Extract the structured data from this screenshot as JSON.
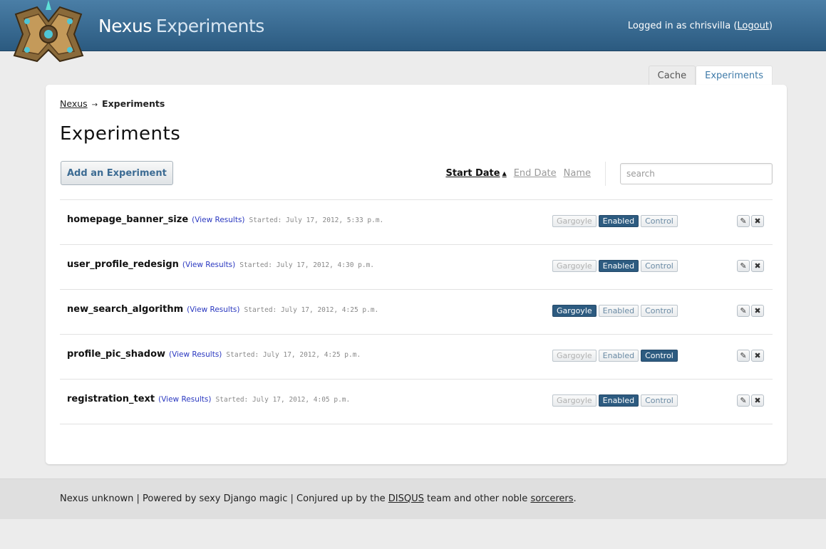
{
  "header": {
    "brand_main": "Nexus",
    "brand_sub": "Experiments",
    "logged_in_text": "Logged in as chrisvilla (",
    "logout_label": "Logout",
    "close_paren": ")"
  },
  "tabs": [
    {
      "label": "Cache",
      "active": false
    },
    {
      "label": "Experiments",
      "active": true
    }
  ],
  "breadcrumb": {
    "root": "Nexus",
    "current": "Experiments"
  },
  "page_title": "Experiments",
  "toolbar": {
    "add_label": "Add an Experiment",
    "sort": {
      "start_date": "Start Date",
      "end_date": "End Date",
      "name": "Name"
    },
    "search_placeholder": "search"
  },
  "experiments": [
    {
      "name": "homepage_banner_size",
      "results_label": "(View Results)",
      "started": "Started: July 17, 2012, 5:33 p.m.",
      "state": "Enabled"
    },
    {
      "name": "user_profile_redesign",
      "results_label": "(View Results)",
      "started": "Started: July 17, 2012, 4:30 p.m.",
      "state": "Enabled"
    },
    {
      "name": "new_search_algorithm",
      "results_label": "(View Results)",
      "started": "Started: July 17, 2012, 4:25 p.m.",
      "state": "Gargoyle"
    },
    {
      "name": "profile_pic_shadow",
      "results_label": "(View Results)",
      "started": "Started: July 17, 2012, 4:25 p.m.",
      "state": "Control"
    },
    {
      "name": "registration_text",
      "results_label": "(View Results)",
      "started": "Started: July 17, 2012, 4:05 p.m.",
      "state": "Enabled"
    }
  ],
  "state_labels": {
    "gargoyle": "Gargoyle",
    "enabled": "Enabled",
    "control": "Control"
  },
  "footer": {
    "part1": "Nexus unknown | Powered by sexy Django magic | Conjured up by the ",
    "disqus": "DISQUS",
    "part2": " team and other noble ",
    "sorcerers": "sorcerers",
    "part3": "."
  },
  "colors": {
    "header": "#2b5a80",
    "accent": "#2d5b80",
    "background": "#ececec"
  }
}
